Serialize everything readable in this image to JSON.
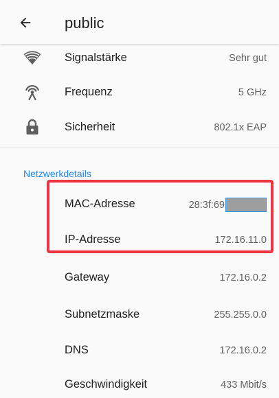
{
  "app_bar": {
    "title": "public",
    "back_icon": "arrow-back-icon"
  },
  "wifi_details": [
    {
      "icon": "wifi-signal-icon",
      "label": "Signalstärke",
      "value": "Sehr gut"
    },
    {
      "icon": "wifi-frequency-icon",
      "label": "Frequenz",
      "value": "5 GHz"
    },
    {
      "icon": "lock-icon",
      "label": "Sicherheit",
      "value": "802.1x EAP"
    }
  ],
  "network_section": {
    "header": "Netzwerkdetails",
    "rows": [
      {
        "label": "MAC-Adresse",
        "value": "28:3f:69",
        "value_redacted": true
      },
      {
        "label": "IP-Adresse",
        "value": "172.16.11.0"
      },
      {
        "label": "Gateway",
        "value": "172.16.0.2"
      },
      {
        "label": "Subnetzmaske",
        "value": "255.255.0.0"
      },
      {
        "label": "DNS",
        "value": "172.16.0.2"
      },
      {
        "label": "Geschwindigkeit",
        "value": "433 Mbit/s"
      }
    ]
  },
  "colors": {
    "accent": "#1e88e5",
    "highlight_border": "#ef3340",
    "redaction_fill": "#9e9e9e"
  }
}
